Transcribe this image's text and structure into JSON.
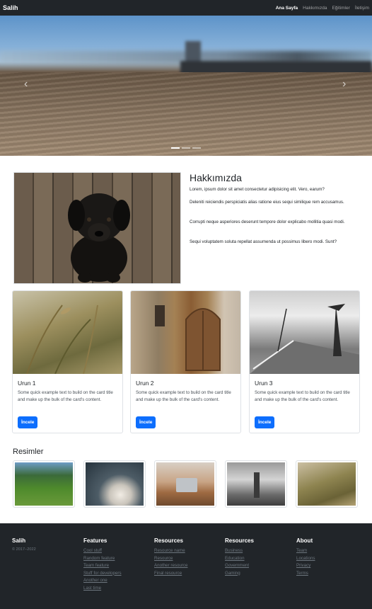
{
  "navbar": {
    "brand": "Salih",
    "links": [
      "Ana Sayfa",
      "Hakkımızda",
      "Eğitimler",
      "İletişim"
    ]
  },
  "about": {
    "title": "Hakkımızda",
    "paragraphs": [
      "Lorem, ipsum dolor sit amet consectetur adipisicing elit. Vero, earum?",
      "Deleniti reiciendis perspiciatis alias ratione eius sequi similique rem accusamus.",
      "Corrupti neque asperiores deserunt tempore dolor explicabo mollitia quasi modi.",
      "Sequi voluptatem soluta repellat assumenda ut possimus libero modi. Sunt?"
    ]
  },
  "cards": [
    {
      "title": "Urun 1",
      "text": "Some quick example text to build on the card title and make up the bulk of the card's content.",
      "button": "İncele"
    },
    {
      "title": "Urun 2",
      "text": "Some quick example text to build on the card title and make up the bulk of the card's content.",
      "button": "İncele"
    },
    {
      "title": "Urun 3",
      "text": "Some quick example text to build on the card title and make up the bulk of the card's content.",
      "button": "İncele"
    }
  ],
  "gallery": {
    "title": "Resimler"
  },
  "footer": {
    "brand": "Salih",
    "copyright": "© 2017–2022",
    "columns": [
      {
        "title": "Features",
        "links": [
          "Cool stuff",
          "Random feature",
          "Team feature",
          "Stuff for developers",
          "Another one",
          "Last time"
        ]
      },
      {
        "title": "Resources",
        "links": [
          "Resource name",
          "Resource",
          "Another resource",
          "Final resource"
        ]
      },
      {
        "title": "Resources",
        "links": [
          "Business",
          "Education",
          "Government",
          "Gaming"
        ]
      },
      {
        "title": "About",
        "links": [
          "Team",
          "Locations",
          "Privacy",
          "Terms"
        ]
      }
    ]
  },
  "colors": {
    "navbar_bg": "#212529",
    "primary_button": "#0d6efd"
  },
  "icons": {
    "carousel_prev": "chevron-left-icon",
    "carousel_next": "chevron-right-icon"
  }
}
